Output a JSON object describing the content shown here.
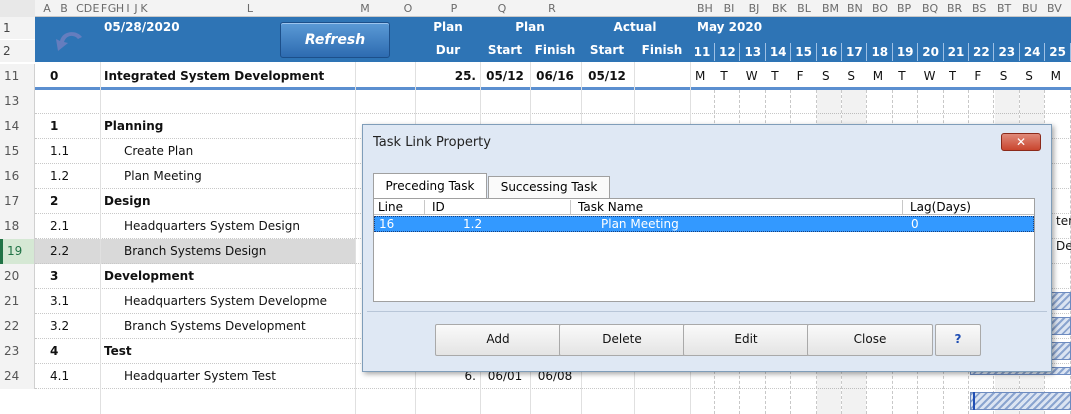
{
  "column_headers": [
    "A",
    "B",
    "C",
    "D",
    "E",
    "F",
    "G",
    "H",
    "I",
    "J",
    "K",
    "L",
    "M",
    "O",
    "P",
    "Q",
    "R",
    "BH",
    "BI",
    "BJ",
    "BK",
    "BL",
    "BM",
    "BN",
    "BO",
    "BP",
    "BQ",
    "BR",
    "BS",
    "BT",
    "BU",
    "BV"
  ],
  "row_headers": [
    "1",
    "2",
    "11",
    "13",
    "14",
    "15",
    "16",
    "17",
    "18",
    "19",
    "20",
    "21",
    "22",
    "23",
    "24"
  ],
  "header": {
    "date": "05/28/2020",
    "refresh_label": "Refresh",
    "plan_label": "Plan",
    "dur_label": "Dur",
    "plan_group": "Plan",
    "actual_group": "Actual",
    "start_label": "Start",
    "finish_label": "Finish",
    "actual_start_label": "Start",
    "actual_finish_label": "Finish",
    "month_label": "May 2020",
    "day_numbers": [
      "11",
      "12",
      "13",
      "14",
      "15",
      "16",
      "17",
      "18",
      "19",
      "20",
      "21",
      "22",
      "23",
      "24",
      "25"
    ],
    "weekdays": [
      "M",
      "T",
      "W",
      "T",
      "F",
      "S",
      "S",
      "M",
      "T",
      "W",
      "T",
      "F",
      "S",
      "S",
      "M"
    ]
  },
  "rows": [
    {
      "row": "11",
      "id": "0",
      "name": "Integrated System Development",
      "dur": "25.",
      "start": "05/12",
      "finish": "06/16",
      "astart": "05/12",
      "afinish": "",
      "bold": true
    },
    {
      "row": "13",
      "id": "",
      "name": "",
      "dur": "",
      "start": "",
      "finish": "",
      "astart": "",
      "afinish": "",
      "bold": false
    },
    {
      "row": "14",
      "id": "1",
      "name": "Planning",
      "dur": "",
      "start": "",
      "finish": "",
      "astart": "",
      "afinish": "",
      "bold": true
    },
    {
      "row": "15",
      "id": "1.1",
      "name": "Create Plan",
      "dur": "",
      "start": "",
      "finish": "",
      "astart": "",
      "afinish": "",
      "bold": false
    },
    {
      "row": "16",
      "id": "1.2",
      "name": "Plan Meeting",
      "dur": "",
      "start": "",
      "finish": "",
      "astart": "",
      "afinish": "",
      "bold": false
    },
    {
      "row": "17",
      "id": "2",
      "name": "Design",
      "dur": "",
      "start": "",
      "finish": "",
      "astart": "",
      "afinish": "",
      "bold": true
    },
    {
      "row": "18",
      "id": "2.1",
      "name": "Headquarters System Design",
      "dur": "",
      "start": "",
      "finish": "",
      "astart": "",
      "afinish": "",
      "bold": false
    },
    {
      "row": "19",
      "id": "2.2",
      "name": "Branch Systems Design",
      "dur": "",
      "start": "",
      "finish": "",
      "astart": "",
      "afinish": "",
      "bold": false
    },
    {
      "row": "20",
      "id": "3",
      "name": "Development",
      "dur": "",
      "start": "",
      "finish": "",
      "astart": "",
      "afinish": "",
      "bold": true
    },
    {
      "row": "21",
      "id": "3.1",
      "name": "Headquarters System Developme",
      "dur": "",
      "start": "",
      "finish": "",
      "astart": "",
      "afinish": "",
      "bold": false
    },
    {
      "row": "22",
      "id": "3.2",
      "name": "Branch Systems Development",
      "dur": "",
      "start": "",
      "finish": "",
      "astart": "",
      "afinish": "",
      "bold": false
    },
    {
      "row": "23",
      "id": "4",
      "name": "Test",
      "dur": "",
      "start": "",
      "finish": "",
      "astart": "",
      "afinish": "",
      "bold": true
    },
    {
      "row": "24",
      "id": "4.1",
      "name": "Headquarter System Test",
      "dur": "6.",
      "start": "06/01",
      "finish": "06/08",
      "astart": "",
      "afinish": "",
      "bold": false
    }
  ],
  "gantt_overflow": {
    "row18": "ter",
    "row19": "Des"
  },
  "dialog": {
    "title": "Task Link Property",
    "tabs": [
      "Preceding Task",
      "Successing Task"
    ],
    "list_headers": [
      "Line",
      "ID",
      "Task Name",
      "Lag(Days)"
    ],
    "list_rows": [
      {
        "line": "16",
        "id": "1.2",
        "name": "Plan Meeting",
        "lag": "0"
      }
    ],
    "buttons": {
      "add": "Add",
      "delete": "Delete",
      "edit": "Edit",
      "close": "Close",
      "help": "?"
    }
  },
  "colors": {
    "header_blue": "#2e74b5",
    "selection_blue": "#3399ff",
    "dialog_bg": "#dfe8f4",
    "hatch": "#8aa4cf",
    "help_blue": "#1f4eb4"
  }
}
